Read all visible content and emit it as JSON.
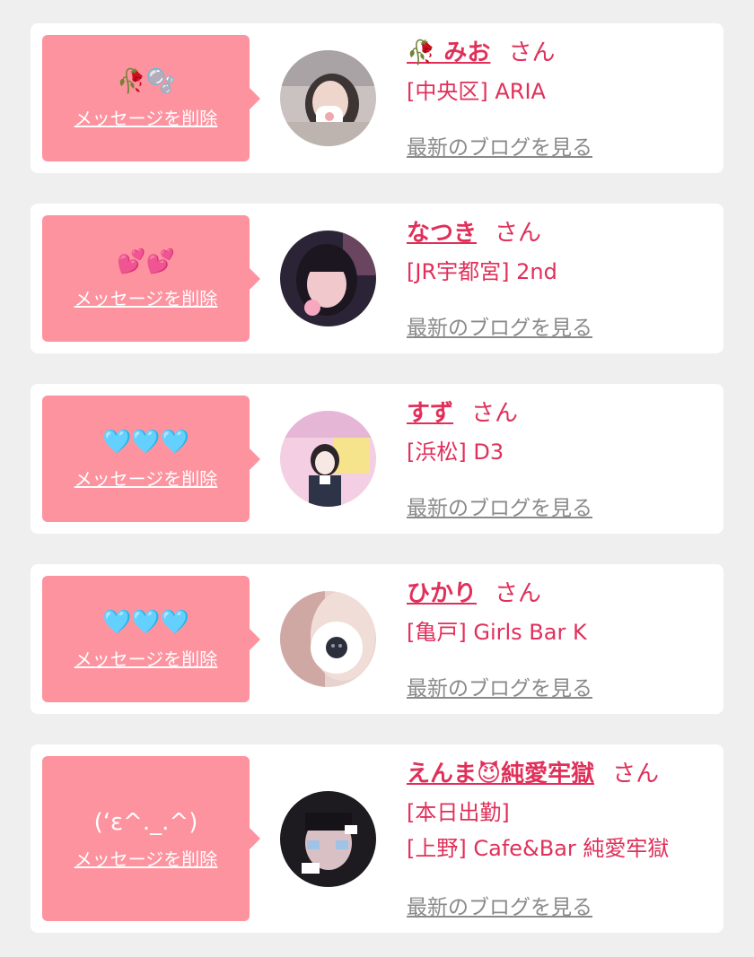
{
  "delete_label": "メッセージを削除",
  "blog_label": "最新のブログを見る",
  "san_label": "さん",
  "colors": {
    "bubble": "#fd939f",
    "accent": "#e0305a",
    "link_gray": "#8a8a8a",
    "background": "#efefef"
  },
  "messages": [
    {
      "message": "🥀🫧",
      "name": "🥀 みお",
      "shop_lines": [
        "[中央区] ARIA"
      ],
      "avatar_icon": "profile-photo-mio"
    },
    {
      "message": "💕💕",
      "name": "なつき",
      "shop_lines": [
        "[JR宇都宮] 2nd"
      ],
      "avatar_icon": "profile-photo-natsuki"
    },
    {
      "message": "🩵🩵🩵",
      "name": "すず",
      "shop_lines": [
        "[浜松] D3"
      ],
      "avatar_icon": "profile-photo-suzu"
    },
    {
      "message": "🩵🩵🩵",
      "name": "ひかり",
      "shop_lines": [
        "[亀戸] Girls Bar K"
      ],
      "avatar_icon": "profile-photo-hikari"
    },
    {
      "message": "(‘ε^._.^)",
      "name": "えんま😈純愛牢獄",
      "shop_lines": [
        "[本日出勤]",
        "[上野] Cafe&Bar 純愛牢獄"
      ],
      "avatar_icon": "profile-photo-enma"
    }
  ]
}
